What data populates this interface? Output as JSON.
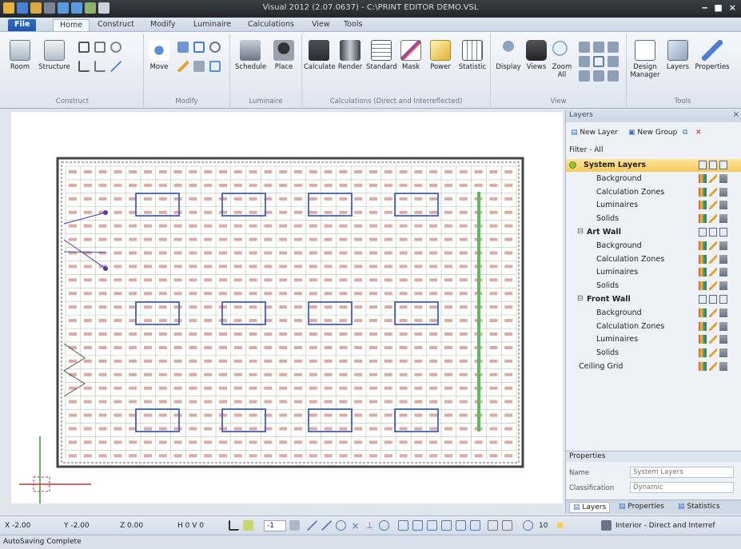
{
  "titlebar": {
    "title": "Visual 2012 (2.07.0637) - C:\\PRINT EDITOR DEMO.VSL",
    "min": "‒",
    "max": "■",
    "close": "×"
  },
  "tabs": [
    "File",
    "Home",
    "Construct",
    "Modify",
    "Luminaire",
    "Calculations",
    "View",
    "Tools"
  ],
  "ribbon": {
    "groups": [
      {
        "label": "Construct",
        "buttons": [
          "Room",
          "Structure"
        ]
      },
      {
        "label": "Modify",
        "buttons": [
          "Move"
        ]
      },
      {
        "label": "Luminaire",
        "buttons": [
          "Schedule",
          "Place"
        ]
      },
      {
        "label": "Calculations (Direct and Interreflected)",
        "buttons": [
          "Calculate",
          "Render",
          "Standard",
          "Mask",
          "Power",
          "Statistic"
        ]
      },
      {
        "label": "View",
        "buttons": [
          "Display",
          "Views",
          "Zoom All"
        ]
      },
      {
        "label": "Tools",
        "buttons": [
          "Design Manager",
          "Layers",
          "Properties"
        ]
      }
    ]
  },
  "layers_panel": {
    "title": "Layers",
    "new_layer": "New Layer",
    "new_group": "New Group",
    "filter_label": "Filter",
    "filter_value": "- All",
    "items": [
      {
        "label": "System Layers",
        "level": 0,
        "selected": true,
        "group": true
      },
      {
        "label": "Background",
        "level": 2
      },
      {
        "label": "Calculation Zones",
        "level": 2
      },
      {
        "label": "Luminaires",
        "level": 2
      },
      {
        "label": "Solids",
        "level": 2
      },
      {
        "label": "Art Wall",
        "level": 1,
        "group": true
      },
      {
        "label": "Background",
        "level": 2
      },
      {
        "label": "Calculation Zones",
        "level": 2
      },
      {
        "label": "Luminaires",
        "level": 2
      },
      {
        "label": "Solids",
        "level": 2
      },
      {
        "label": "Front Wall",
        "level": 1,
        "group": true
      },
      {
        "label": "Background",
        "level": 2
      },
      {
        "label": "Calculation Zones",
        "level": 2
      },
      {
        "label": "Luminaires",
        "level": 2
      },
      {
        "label": "Solids",
        "level": 2
      },
      {
        "label": "Ceiling Grid",
        "level": 1
      }
    ]
  },
  "properties": {
    "title": "Properties",
    "name_label": "Name",
    "name_value": "System Layers",
    "class_label": "Classification",
    "class_value": "Dynamic"
  },
  "bottom_tabs": [
    "Layers",
    "Properties",
    "Statistics"
  ],
  "coords": {
    "x": "X -2.00",
    "y": "Y -2.00",
    "z": "Z 0.00",
    "hv": "H 0 V 0",
    "level": "-1",
    "count": "10",
    "mode": "Interior - Direct and Interref"
  },
  "status": "AutoSaving Complete",
  "colors": {
    "accent": "#1d56a8",
    "selected": "#f7c95a",
    "grid": "#b9c7a8",
    "fixture": "#3e5fcf",
    "label": "#b0443a"
  }
}
